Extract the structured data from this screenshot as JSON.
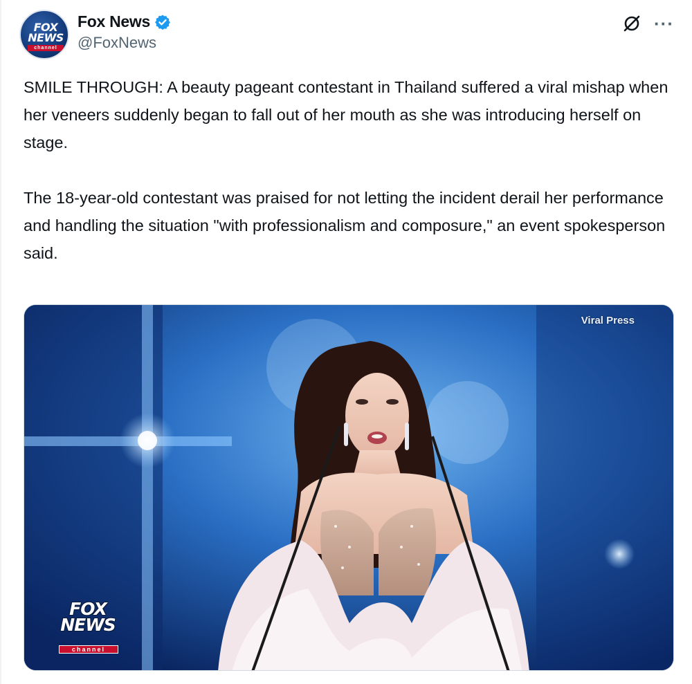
{
  "author": {
    "display_name": "Fox News",
    "handle": "@FoxNews",
    "avatar": {
      "logo_top": "FOX",
      "logo_bottom": "NEWS",
      "logo_bar": "channel"
    }
  },
  "header": {
    "verified_icon": "verified-badge-icon",
    "grok_icon": "grok-icon",
    "more_icon": "more-options-icon",
    "more_glyph": "···"
  },
  "tweet": {
    "paragraphs": [
      "SMILE THROUGH: A beauty pageant contestant in Thailand suffered a viral mishap when her veneers suddenly began to fall out of her mouth as she was introducing herself on stage.",
      "The 18-year-old contestant was praised for not letting the incident derail her performance and handling the situation \"with professionalism and composure,\" an event spokesperson said."
    ]
  },
  "media": {
    "watermark": "Viral Press",
    "bug": {
      "line1": "FOX",
      "line2": "NEWS",
      "bar": "channel"
    }
  },
  "colors": {
    "text_primary": "#0f1419",
    "text_secondary": "#536471",
    "verified_blue": "#1d9bf0",
    "fox_red": "#c8102e",
    "fox_blue": "#123a7a"
  }
}
